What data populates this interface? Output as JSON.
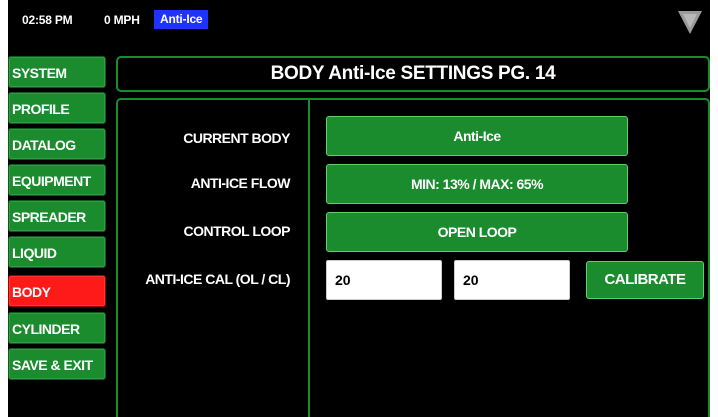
{
  "status": {
    "time": "02:58 PM",
    "speed": "0 MPH",
    "mode": "Anti-Ice",
    "signal_icon": "signal-strength-icon"
  },
  "sidebar": {
    "items": [
      {
        "label": "SYSTEM",
        "active": false
      },
      {
        "label": "PROFILE",
        "active": false
      },
      {
        "label": "DATALOG",
        "active": false
      },
      {
        "label": "EQUIPMENT",
        "active": false
      },
      {
        "label": "SPREADER",
        "active": false
      },
      {
        "label": "LIQUID",
        "active": false
      },
      {
        "label": "BODY",
        "active": true
      },
      {
        "label": "CYLINDER",
        "active": false
      },
      {
        "label": "SAVE & EXIT",
        "active": false
      }
    ]
  },
  "page": {
    "title": "BODY Anti-Ice SETTINGS PG. 14"
  },
  "settings": {
    "current_body": {
      "label": "CURRENT BODY",
      "value": "Anti-Ice"
    },
    "anti_ice_flow": {
      "label": "ANTI-ICE FLOW",
      "value": "MIN: 13% / MAX: 65%"
    },
    "control_loop": {
      "label": "CONTROL LOOP",
      "value": "OPEN LOOP"
    },
    "anti_ice_cal": {
      "label": "ANTI-ICE CAL (OL / CL)",
      "ol_value": "20",
      "cl_value": "20",
      "button_label": "CALIBRATE"
    }
  },
  "colors": {
    "button_green": "#1a8c2e",
    "active_red": "#ff1a1a",
    "mode_blue": "#1f33ff",
    "background": "#000000"
  }
}
